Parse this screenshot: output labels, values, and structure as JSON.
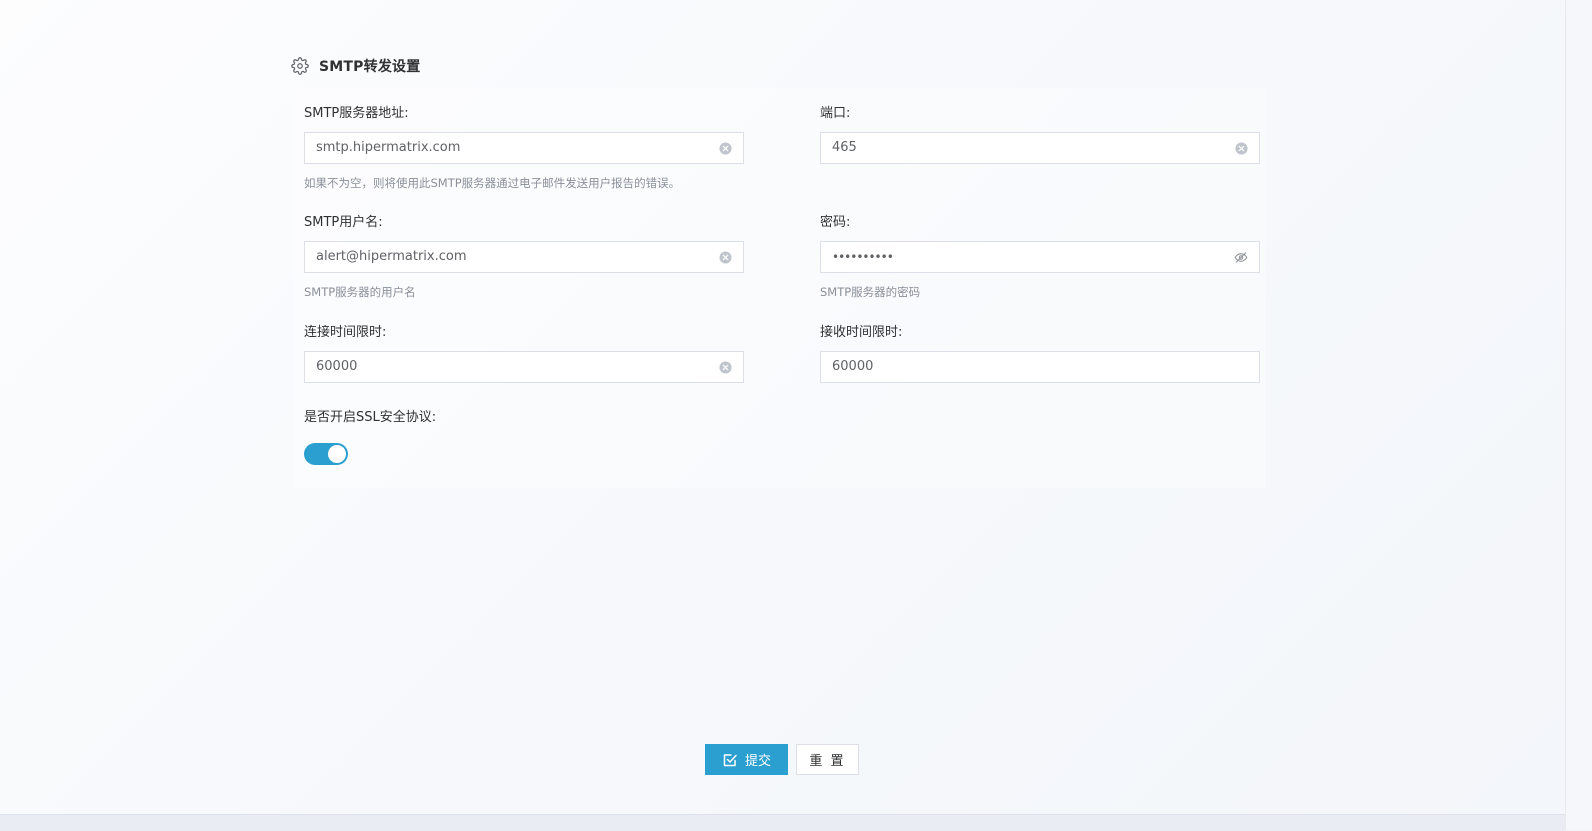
{
  "section": {
    "title": "SMTP转发设置",
    "icon": "gear-icon"
  },
  "form": {
    "smtp_host": {
      "label": "SMTP服务器地址:",
      "value": "smtp.hipermatrix.com",
      "hint": "如果不为空，则将使用此SMTP服务器通过电子邮件发送用户报告的错误。"
    },
    "port": {
      "label": "端口:",
      "value": "465"
    },
    "username": {
      "label": "SMTP用户名:",
      "value": "alert@hipermatrix.com",
      "hint": "SMTP服务器的用户名"
    },
    "password": {
      "label": "密码:",
      "value": "••••••••••",
      "hint": "SMTP服务器的密码"
    },
    "connect_timeout": {
      "label": "连接时间限时:",
      "value": "60000"
    },
    "receive_timeout": {
      "label": "接收时间限时:",
      "value": "60000"
    },
    "ssl": {
      "label": "是否开启SSL安全协议:",
      "enabled": true
    }
  },
  "actions": {
    "submit_label": "提交",
    "reset_label": "重 置"
  },
  "colors": {
    "primary": "#2b9fcf",
    "border": "#dcdfe6",
    "text": "#303133",
    "hint": "#8a8f99"
  }
}
